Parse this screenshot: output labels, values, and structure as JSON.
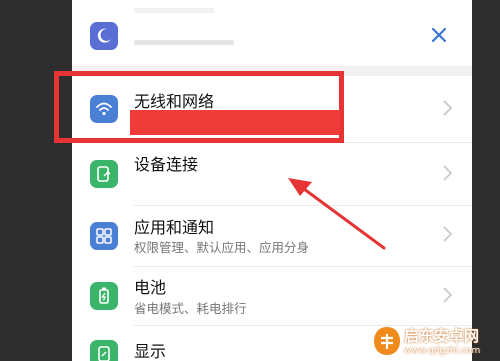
{
  "rows": [
    {
      "title": "无线和网络",
      "subtitle": "",
      "icon": "wifi-icon",
      "color": "#4a7fd6"
    },
    {
      "title": "设备连接",
      "subtitle": "",
      "icon": "device-connect-icon",
      "color": "#3bb56a"
    },
    {
      "title": "应用和通知",
      "subtitle": "权限管理、默认应用、应用分身",
      "icon": "apps-icon",
      "color": "#4a7fd6"
    },
    {
      "title": "电池",
      "subtitle": "省电模式、耗电排行",
      "icon": "battery-icon",
      "color": "#3bb56a"
    },
    {
      "title": "显示",
      "subtitle": "",
      "icon": "display-icon",
      "color": "#3bb56a"
    }
  ],
  "top_item": {
    "icon": "moon-icon",
    "color": "#5a6fd6",
    "close_icon": "close-icon"
  },
  "colors": {
    "highlight": "#e63434",
    "arrow": "#e63434"
  },
  "watermark": {
    "line1": "启东安卓网",
    "line2": "www.qdgzhl.com",
    "logo": "logo-icon"
  }
}
